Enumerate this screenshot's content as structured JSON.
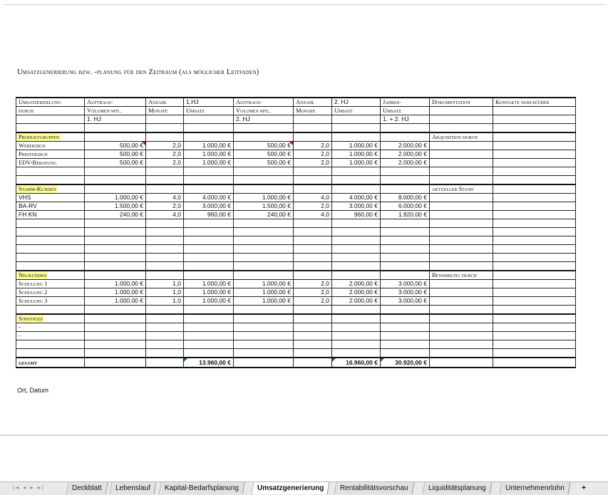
{
  "title": "Umsatzgenerierung bzw. -planung für den Zeitraum (als möglicher Leitfaden)",
  "headers": {
    "r1": [
      "Umsatzerzielung",
      "Auftrags-",
      "Anzahl",
      "1.HJ",
      "Auftrags-",
      "Anzahl",
      "2. HJ",
      "Jahres-",
      "Dokumentation",
      "Kontakte durch/über"
    ],
    "r2": [
      "durch",
      "Volumen mtl.",
      "Monate",
      "Umsatz",
      "Volumen mtl.",
      "Monate",
      "Umsatz",
      "Umsatz",
      "",
      ""
    ],
    "r3": [
      "",
      "1. HJ",
      "",
      "",
      "2. HJ",
      "",
      "",
      "1. + 2. HJ",
      "",
      ""
    ]
  },
  "sections": {
    "produkt": {
      "label": "Produktgruppen",
      "doc": "Akquisition durch",
      "rows": [
        [
          "Webdesign",
          "500,00 €",
          "2,0",
          "1.000,00 €",
          "500,00 €",
          "2,0",
          "1.000,00 €",
          "2.000,00 €"
        ],
        [
          "Printdesign",
          "500,00 €",
          "2,0",
          "1.000,00 €",
          "500,00 €",
          "2,0",
          "1.000,00 €",
          "2.000,00 €"
        ],
        [
          "EDV-Beratung",
          "500,00 €",
          "2,0",
          "1.000,00 €",
          "500,00 €",
          "2,0",
          "1.000,00 €",
          "2.000,00 €"
        ]
      ]
    },
    "stamm": {
      "label": "Stamm-Kunden",
      "doc": "aktueller Stand",
      "rows": [
        [
          "VHS",
          "1.000,00 €",
          "4,0",
          "4.000,00 €",
          "1.000,00 €",
          "4,0",
          "4.000,00 €",
          "8.000,00 €"
        ],
        [
          "BA-RV",
          "1.500,00 €",
          "2,0",
          "3.000,00 €",
          "1.500,00 €",
          "2,0",
          "3.000,00 €",
          "6.000,00 €"
        ],
        [
          "FH KN",
          "240,00 €",
          "4,0",
          "960,00 €",
          "240,00 €",
          "4,0",
          "960,00 €",
          "1.920,00 €"
        ]
      ]
    },
    "neu": {
      "label": "Neukunden",
      "doc": "Bewerbung durch",
      "rows": [
        [
          "Schulung 1",
          "1.000,00 €",
          "1,0",
          "1.000,00 €",
          "1.000,00 €",
          "2,0",
          "2.000,00 €",
          "3.000,00 €"
        ],
        [
          "Schulung 2",
          "1.000,00 €",
          "1,0",
          "1.000,00 €",
          "1.000,00 €",
          "2,0",
          "2.000,00 €",
          "3.000,00 €"
        ],
        [
          "Schulung 3",
          "1.000,00 €",
          "1,0",
          "1.000,00 €",
          "1.000,00 €",
          "2,0",
          "2.000,00 €",
          "3.000,00 €"
        ]
      ]
    },
    "sonst": {
      "label": "Sonstiges",
      "rows": [
        [
          "-"
        ],
        [
          "-"
        ]
      ]
    }
  },
  "total": {
    "label": "gesamt",
    "hj1": "13.960,00 €",
    "hj2": "16.960,00 €",
    "year": "30.920,00 €"
  },
  "footer_text": "Ort, Datum",
  "tab_nav": "|◂ ◂ ▸ ▸|",
  "tabs": [
    "Deckblatt",
    "Lebenslauf",
    "Kapital-Bedarfsplanung",
    "Umsatzgenerierung",
    "Rentabilitätsvorschau",
    "Liquiditätsplanung",
    "Unternehmenrlohn"
  ],
  "active_tab": "Umsatzgenerierung",
  "add_tab": "+"
}
